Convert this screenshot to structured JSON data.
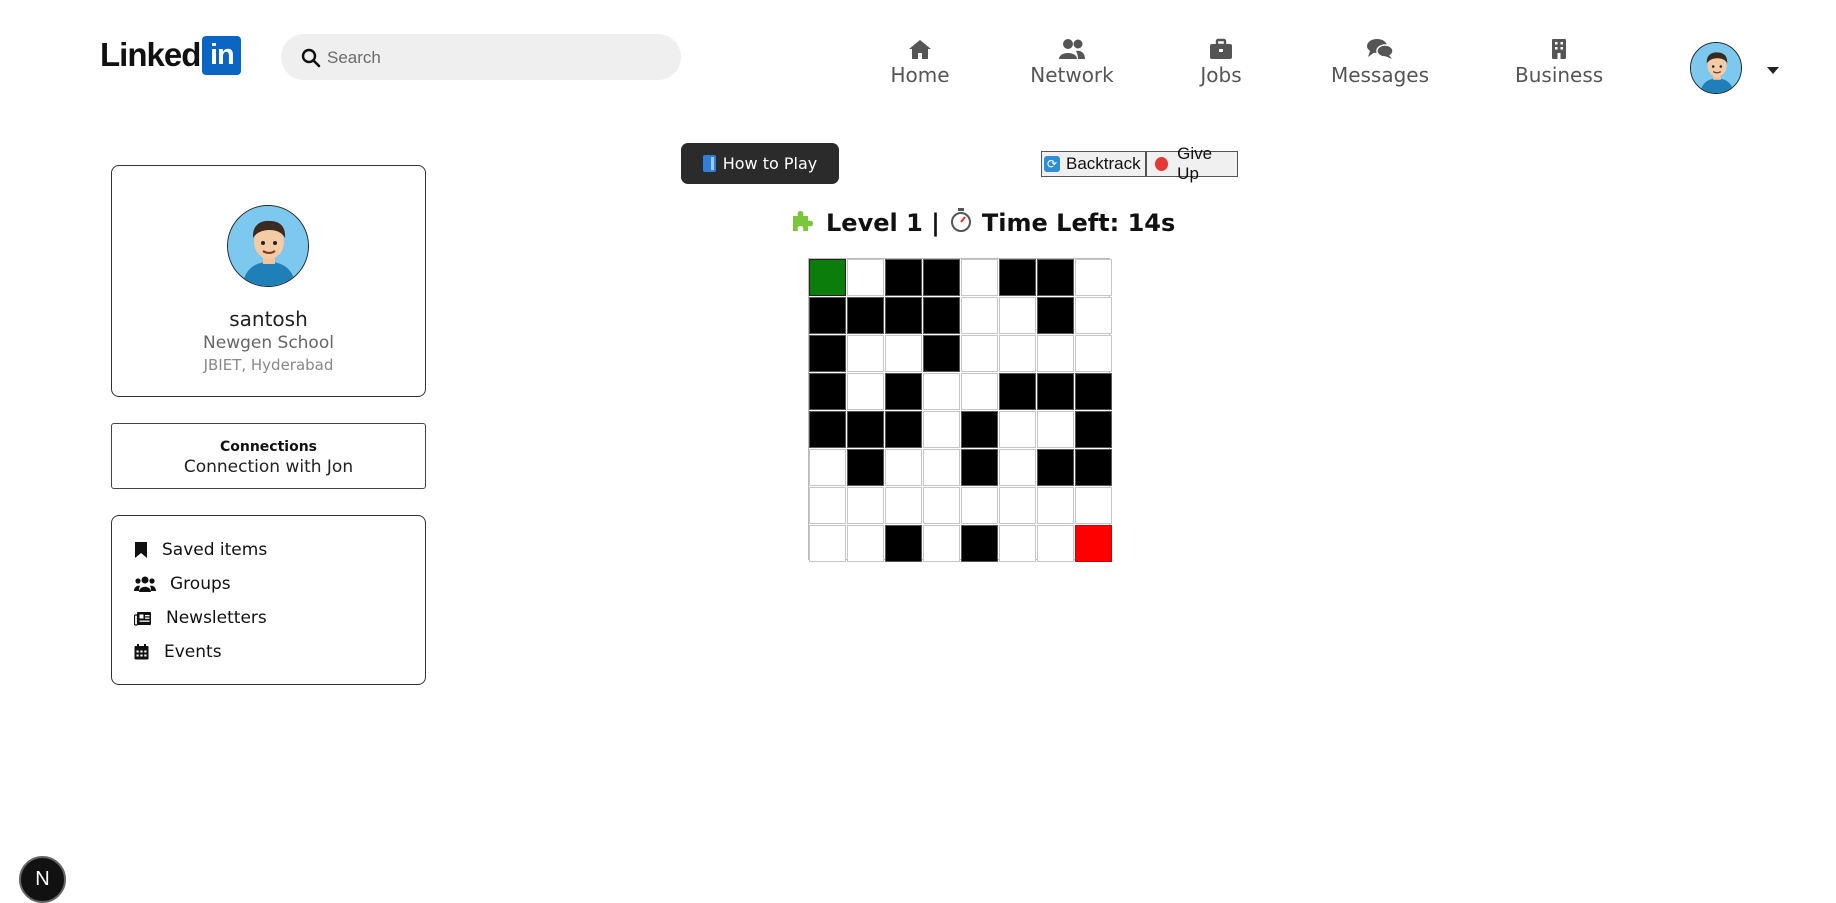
{
  "header": {
    "logo_text": "Linked",
    "logo_box": "in",
    "search_placeholder": "Search",
    "nav": [
      {
        "label": "Home",
        "icon": "home-icon"
      },
      {
        "label": "Network",
        "icon": "people-icon"
      },
      {
        "label": "Jobs",
        "icon": "briefcase-icon"
      },
      {
        "label": "Messages",
        "icon": "chat-icon"
      },
      {
        "label": "Business",
        "icon": "building-icon"
      }
    ]
  },
  "profile": {
    "name": "santosh",
    "school": "Newgen School",
    "college": "JBIET, Hyderabad"
  },
  "connections": {
    "title": "Connections",
    "subtitle": "Connection with Jon"
  },
  "menu": [
    {
      "label": "Saved items",
      "icon": "bookmark-icon"
    },
    {
      "label": "Groups",
      "icon": "groups-icon"
    },
    {
      "label": "Newsletters",
      "icon": "newspaper-icon"
    },
    {
      "label": "Events",
      "icon": "calendar-icon"
    }
  ],
  "game": {
    "how_to_play": "How to Play",
    "backtrack": "Backtrack",
    "give_up": "Give Up",
    "level_text": "Level 1 |",
    "time_left": "Time Left: 14s",
    "grid_size": 8,
    "legend": {
      "0": "open",
      "1": "wall",
      "S": "start",
      "G": "goal"
    },
    "grid": [
      [
        "S",
        "0",
        "1",
        "1",
        "0",
        "1",
        "1",
        "0"
      ],
      [
        "1",
        "1",
        "1",
        "1",
        "0",
        "0",
        "1",
        "0"
      ],
      [
        "1",
        "0",
        "0",
        "1",
        "0",
        "0",
        "0",
        "0"
      ],
      [
        "1",
        "0",
        "1",
        "0",
        "0",
        "1",
        "1",
        "1"
      ],
      [
        "1",
        "1",
        "1",
        "0",
        "1",
        "0",
        "0",
        "1"
      ],
      [
        "0",
        "1",
        "0",
        "0",
        "1",
        "0",
        "1",
        "1"
      ],
      [
        "0",
        "0",
        "0",
        "0",
        "0",
        "0",
        "0",
        "0"
      ],
      [
        "0",
        "0",
        "1",
        "0",
        "1",
        "0",
        "0",
        "G"
      ]
    ],
    "colors": {
      "start": "#0a7d0a",
      "goal": "#ff0000",
      "wall": "#000000"
    }
  },
  "dev_badge": "N"
}
